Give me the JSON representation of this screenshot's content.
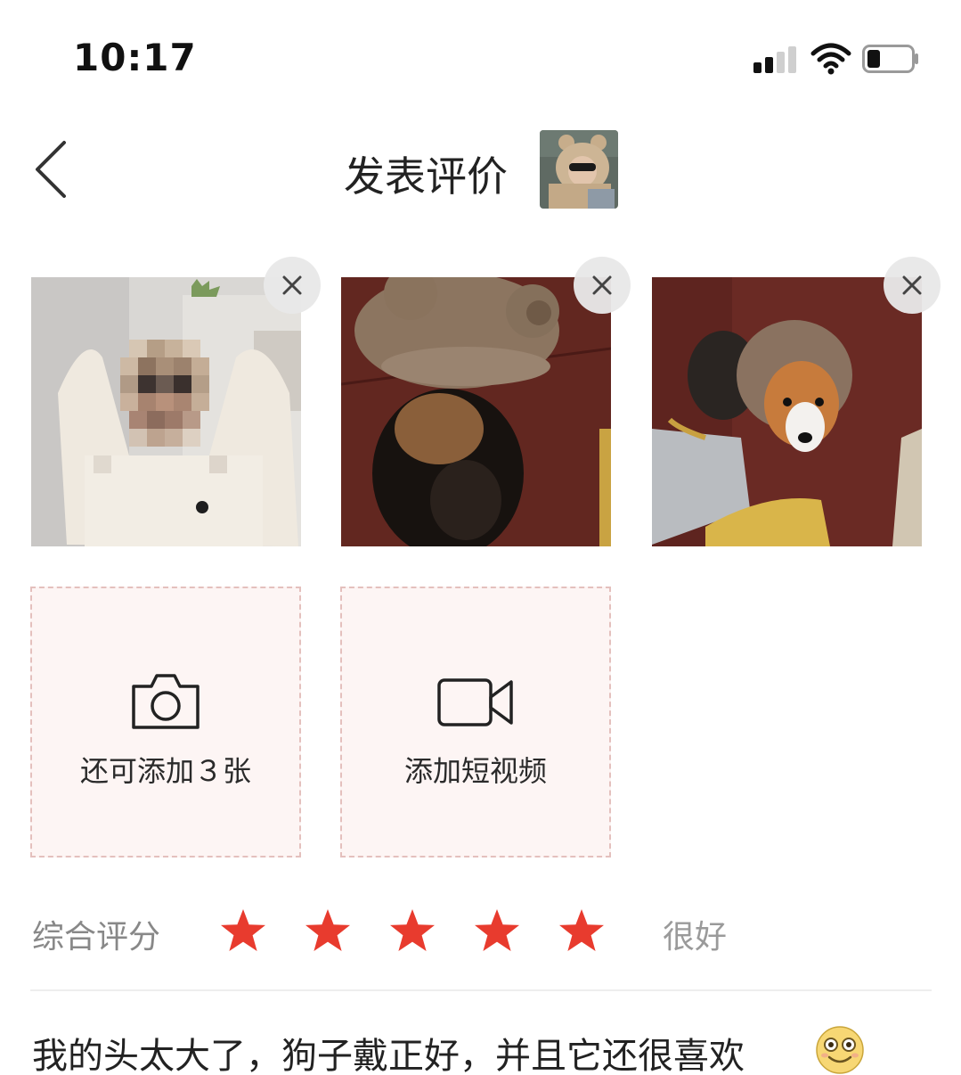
{
  "status_bar": {
    "time": "10:17",
    "icons": [
      "signal-icon",
      "wifi-icon",
      "battery-icon"
    ],
    "battery_level": 0.3
  },
  "nav": {
    "back_icon": "chevron-left-icon",
    "title": "发表评价"
  },
  "photos": [
    {
      "name": "photo-person-in-hat",
      "remove_icon": "close-icon"
    },
    {
      "name": "photo-dog-back-in-hat",
      "remove_icon": "close-icon"
    },
    {
      "name": "photo-corgi-in-hat",
      "remove_icon": "close-icon"
    }
  ],
  "add_tiles": {
    "photo_label": "还可添加３张",
    "photo_icon": "camera-icon",
    "video_label": "添加短视频",
    "video_icon": "video-camera-icon"
  },
  "rating": {
    "label": "综合评分",
    "stars": 5,
    "max_stars": 5,
    "star_color": "#e83b2e",
    "text": "很好"
  },
  "review": {
    "text": "我的头太大了，狗子戴正好，并且它还很喜欢",
    "emoji_icon": "smiling-face-emoji-icon"
  },
  "colors": {
    "accent": "#e83b2e",
    "tile_background": "#fdf5f4",
    "tile_border": "#e4c0bd"
  }
}
